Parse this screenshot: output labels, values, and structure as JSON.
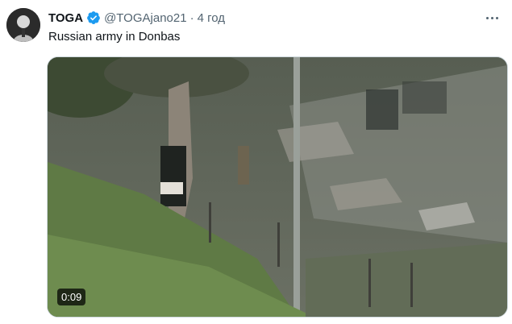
{
  "tweet": {
    "display_name": "TOGA",
    "handle": "@TOGAjano21",
    "separator": "·",
    "time_ago": "4 год",
    "text": "Russian army in Donbas",
    "verified": true,
    "accent_color": "#1d9bf0"
  },
  "media": {
    "type": "video",
    "duration": "0:09"
  },
  "icons": {
    "avatar": "profile-photo",
    "verified": "verified-badge-icon",
    "more": "more-options-icon"
  }
}
